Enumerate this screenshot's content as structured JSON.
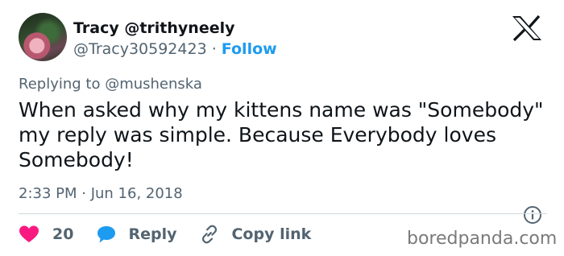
{
  "tweet": {
    "author": {
      "display_name": "Tracy @trithyneely",
      "handle": "@Tracy30592423",
      "separator": " · ",
      "follow_label": "Follow"
    },
    "replying_to": "Replying to @mushenska",
    "text": "When asked why my kittens name was \"Somebody\" my reply was simple. Because Everybody loves Somebody!",
    "timestamp": "2:33 PM · Jun 16, 2018"
  },
  "actions": {
    "like_count": "20",
    "reply_label": "Reply",
    "copy_link_label": "Copy link"
  },
  "watermark": "boredpanda.com",
  "icons": {
    "brand": "x-logo-icon",
    "like": "heart-icon",
    "reply": "speech-bubble-icon",
    "copy": "link-icon",
    "info": "info-icon"
  },
  "colors": {
    "text": "#0f1419",
    "secondary": "#536471",
    "follow": "#1d9bf0",
    "like": "#f91880",
    "reply": "#1d9bf0",
    "divider": "#cfd9de"
  }
}
